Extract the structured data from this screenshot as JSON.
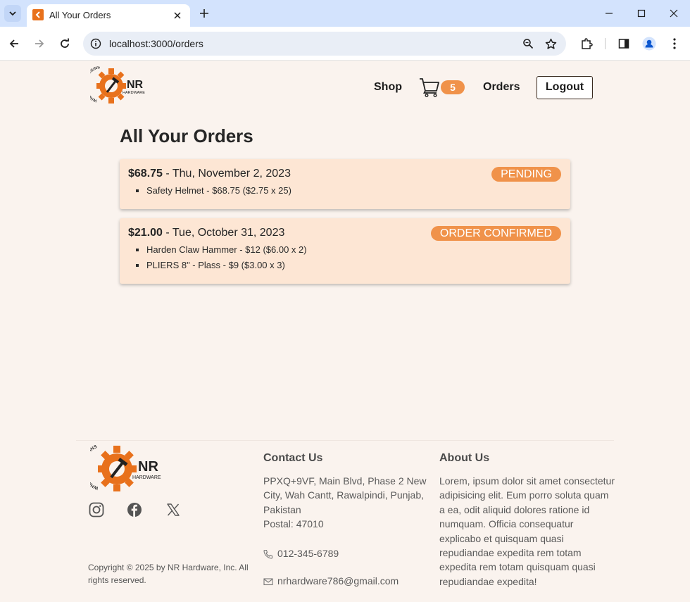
{
  "browser": {
    "tab_title": "All Your Orders",
    "url": "localhost:3000/orders"
  },
  "header": {
    "logo_text": "NR",
    "logo_subtext": "HARDWARE",
    "logo_ring_text": "WHERE WORK BEGINS",
    "nav": {
      "shop": "Shop",
      "orders": "Orders",
      "logout": "Logout"
    },
    "cart_count": "5"
  },
  "main": {
    "title": "All Your Orders",
    "orders": [
      {
        "total": "$68.75",
        "date": " - Thu, November 2, 2023",
        "status": "PENDING",
        "items": [
          "Safety Helmet - $68.75 ($2.75 x 25)"
        ]
      },
      {
        "total": "$21.00",
        "date": " - Tue, October 31, 2023",
        "status": "ORDER CONFIRMED",
        "items": [
          "Harden Claw Hammer - $12 ($6.00 x 2)",
          "PLIERS 8\" - Plass - $9 ($3.00 x 3)"
        ]
      }
    ]
  },
  "footer": {
    "copyright_line1": "Copyright © 2025 by NR Hardware, Inc. All",
    "copyright_line2": "rights reserved.",
    "contact": {
      "heading": "Contact Us",
      "address_lines": [
        "PPXQ+9VF, Main Blvd, Phase 2 New",
        "City, Wah Cantt, Rawalpindi, Punjab,",
        "Pakistan",
        "Postal: 47010"
      ],
      "phone": "012-345-6789",
      "email": "nrhardware786@gmail.com"
    },
    "about": {
      "heading": "About Us",
      "lines": [
        "Lorem, ipsum dolor sit amet consectetur",
        "adipisicing elit. Eum porro soluta quam",
        "a ea, odit aliquid dolores ratione id",
        "numquam. Officia consequatur",
        "explicabo et quisquam quasi",
        "repudiandae expedita rem totam",
        "expedita rem totam quisquam quasi",
        "repudiandae expedita!"
      ]
    },
    "social_icons": [
      "instagram-icon",
      "facebook-icon",
      "x-twitter-icon"
    ]
  },
  "colors": {
    "accent": "#f0924a",
    "card": "#fde6d4",
    "page_bg": "#faf3ee"
  }
}
